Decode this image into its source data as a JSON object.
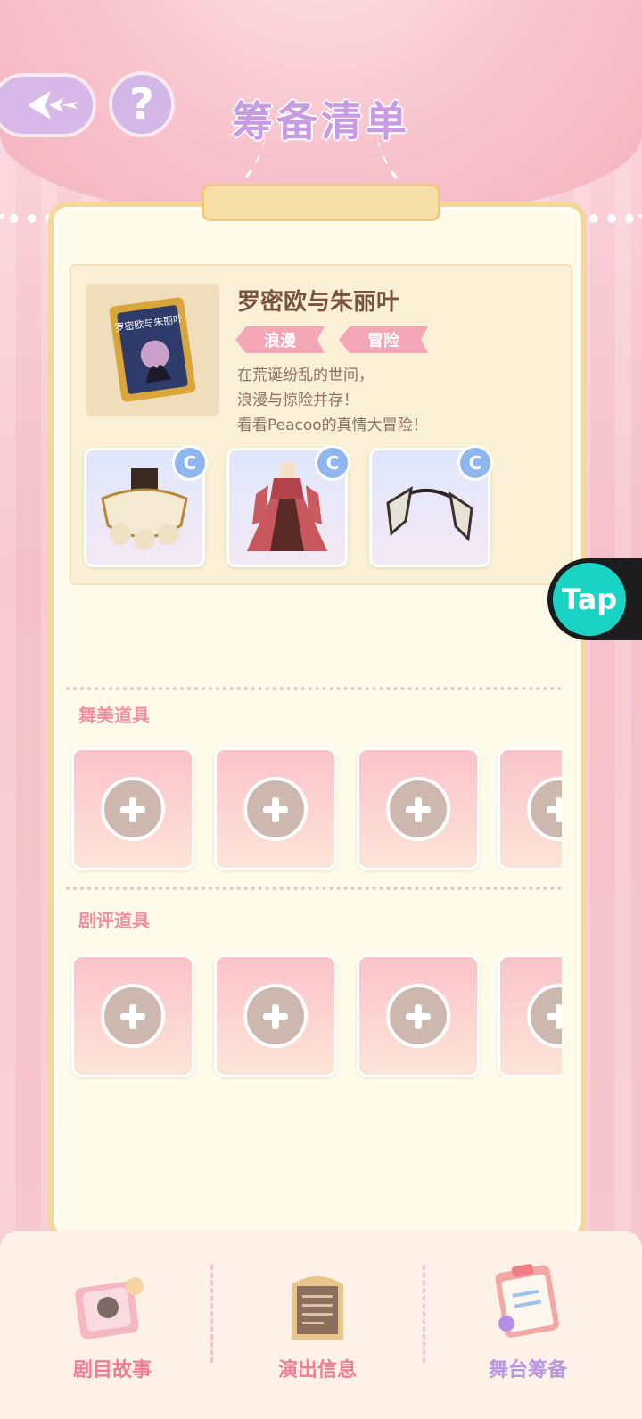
{
  "header": {
    "title": "筹备清单",
    "help_label": "?"
  },
  "play": {
    "cover_title": "罗密欧与朱丽叶",
    "name": "罗密欧与朱丽叶",
    "tags": [
      "浪漫",
      "冒险"
    ],
    "description_lines": [
      "在荒诞纷乱的世间，",
      "浪漫与惊险并存！",
      "看看Peacoo的真情大冒险！"
    ],
    "costumes": [
      {
        "name": "costume-1",
        "rarity": "C"
      },
      {
        "name": "costume-2",
        "rarity": "C"
      },
      {
        "name": "costume-3",
        "rarity": "C"
      }
    ]
  },
  "floating_badge": {
    "label": "Tap",
    "color": "#19d3c5"
  },
  "sections": [
    {
      "label": "舞美道具",
      "slot_count": 4
    },
    {
      "label": "剧评道具",
      "slot_count": 4
    }
  ],
  "bottom_nav": {
    "items": [
      {
        "label": "剧目故事",
        "active": false
      },
      {
        "label": "演出信息",
        "active": false
      },
      {
        "label": "舞台筹备",
        "active": true
      }
    ]
  },
  "colors": {
    "accent_pink": "#f08ea2",
    "accent_purple": "#c79ce0",
    "frame_gold": "#f5d79a"
  }
}
